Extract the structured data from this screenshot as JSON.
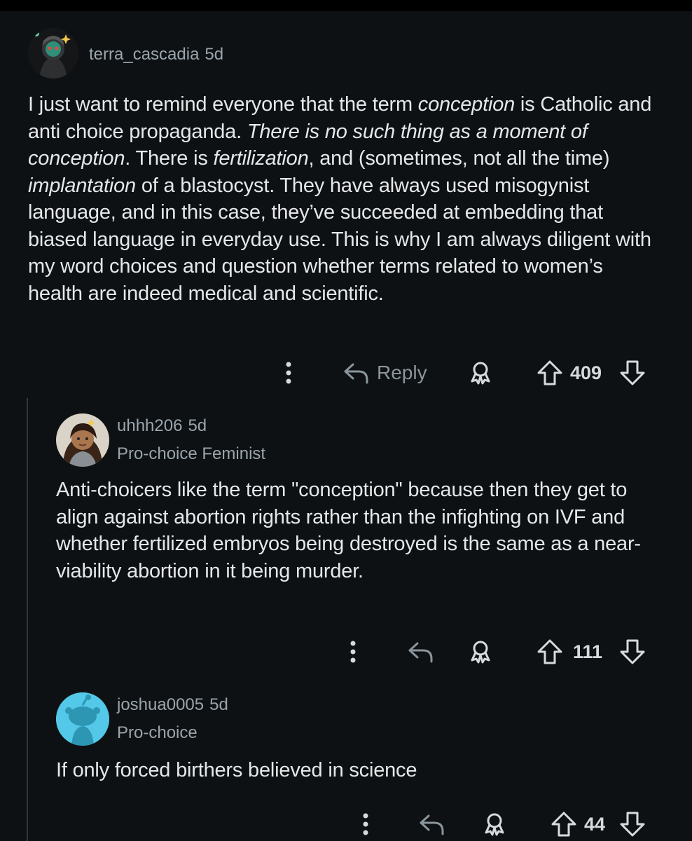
{
  "comments": [
    {
      "username": "terra_cascadia",
      "age": "5d",
      "flair": "",
      "body": {
        "p1": "I just want to remind everyone that the term ",
        "e1": "conception",
        "p2": " is Catholic and anti choice propaganda. ",
        "e2": "There is no such thing as a moment of conception",
        "p3": ". There is ",
        "e3": "fertilization",
        "p4": ", and (sometimes, not all the time) ",
        "e4": "implantation",
        "p5": " of a blastocyst. They have always used misogynist language, and in this case, they’ve succeeded at embedding that biased language in everyday use. This is why I am always diligent with my word choices and question whether terms related to women’s health are indeed medical and scientific."
      },
      "reply_label": "Reply",
      "score": "409"
    },
    {
      "username": "uhhh206",
      "age": "5d",
      "flair": "Pro-choice Feminist",
      "body": "Anti-choicers like the term \"conception\" because then they get to align against abortion rights rather than the infighting on IVF and whether fertilized embryos being destroyed is the same as a near-viability abortion in it being murder.",
      "score": "111"
    },
    {
      "username": "joshua0005",
      "age": "5d",
      "flair": "Pro-choice",
      "body": "If only forced birthers believed in science",
      "score": "44"
    }
  ],
  "icons": {
    "more": "more-vertical-icon",
    "reply": "reply-arrow-icon",
    "award": "award-icon",
    "upvote": "upvote-arrow-icon",
    "downvote": "downvote-arrow-icon"
  },
  "colors": {
    "background": "#0e1113",
    "text": "#e5e7e9",
    "meta": "#9aa5ad",
    "icon": "#8a959c",
    "default_avatar": "#53c8e8"
  }
}
